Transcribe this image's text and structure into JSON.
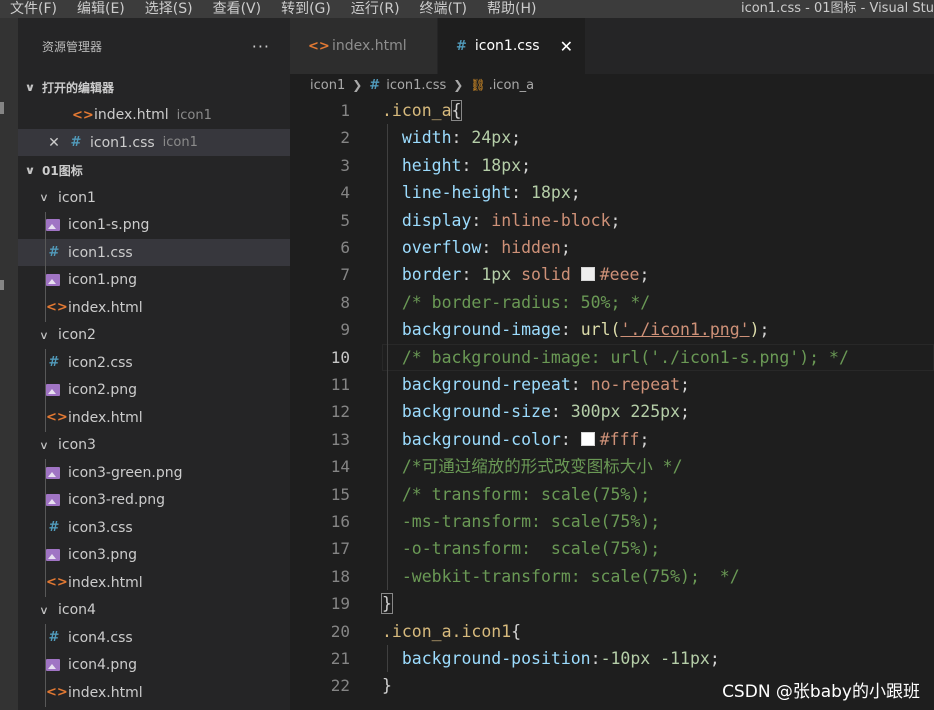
{
  "menu": {
    "items": [
      "文件(F)",
      "编辑(E)",
      "选择(S)",
      "查看(V)",
      "转到(G)",
      "运行(R)",
      "终端(T)",
      "帮助(H)"
    ],
    "window_title": "icon1.css - 01图标 - Visual Stu"
  },
  "sidebar": {
    "title": "资源管理器",
    "more": "···",
    "open_editors_label": "打开的编辑器",
    "open_editors": [
      {
        "name": "index.html",
        "desc": "icon1"
      },
      {
        "name": "icon1.css",
        "desc": "icon1"
      }
    ],
    "root_label": "01图标",
    "folders": [
      {
        "name": "icon1",
        "files": [
          "icon1-s.png",
          "icon1.css",
          "icon1.png",
          "index.html"
        ]
      },
      {
        "name": "icon2",
        "files": [
          "icon2.css",
          "icon2.png",
          "index.html"
        ]
      },
      {
        "name": "icon3",
        "files": [
          "icon3-green.png",
          "icon3-red.png",
          "icon3.css",
          "icon3.png",
          "index.html"
        ]
      },
      {
        "name": "icon4",
        "files": [
          "icon4.css",
          "icon4.png",
          "index.html"
        ]
      }
    ]
  },
  "tabs": [
    {
      "label": "index.html",
      "icon": "html-file-icon",
      "active": false
    },
    {
      "label": "icon1.css",
      "icon": "css-file-icon",
      "active": true
    }
  ],
  "breadcrumb": {
    "folder": "icon1",
    "file": "icon1.css",
    "symbol": ".icon_a"
  },
  "editor": {
    "current_line": 10,
    "line_numbers": [
      "1",
      "2",
      "3",
      "4",
      "5",
      "6",
      "7",
      "8",
      "9",
      "10",
      "11",
      "12",
      "13",
      "14",
      "15",
      "16",
      "17",
      "18",
      "19",
      "20",
      "21",
      "22"
    ],
    "lines": [
      [
        {
          "t": ".icon_a",
          "c": "sel"
        },
        {
          "t": "{",
          "c": "punc",
          "hl": true
        }
      ],
      [
        {
          "t": "  "
        },
        {
          "t": "width",
          "c": "prop"
        },
        {
          "t": ": "
        },
        {
          "t": "24px",
          "c": "num"
        },
        {
          "t": ";"
        }
      ],
      [
        {
          "t": "  "
        },
        {
          "t": "height",
          "c": "prop"
        },
        {
          "t": ": "
        },
        {
          "t": "18px",
          "c": "num"
        },
        {
          "t": ";"
        }
      ],
      [
        {
          "t": "  "
        },
        {
          "t": "line-height",
          "c": "prop"
        },
        {
          "t": ": "
        },
        {
          "t": "18px",
          "c": "num"
        },
        {
          "t": ";"
        }
      ],
      [
        {
          "t": "  "
        },
        {
          "t": "display",
          "c": "prop"
        },
        {
          "t": ": "
        },
        {
          "t": "inline-block",
          "c": "val"
        },
        {
          "t": ";"
        }
      ],
      [
        {
          "t": "  "
        },
        {
          "t": "overflow",
          "c": "prop"
        },
        {
          "t": ": "
        },
        {
          "t": "hidden",
          "c": "val"
        },
        {
          "t": ";"
        }
      ],
      [
        {
          "t": "  "
        },
        {
          "t": "border",
          "c": "prop"
        },
        {
          "t": ": "
        },
        {
          "t": "1px",
          "c": "num"
        },
        {
          "t": " "
        },
        {
          "t": "solid",
          "c": "val"
        },
        {
          "t": " "
        },
        {
          "swatch": "#eeeeee"
        },
        {
          "t": "#eee",
          "c": "val"
        },
        {
          "t": ";"
        }
      ],
      [
        {
          "t": "  "
        },
        {
          "t": "/* border-radius: 50%; */",
          "c": "com"
        }
      ],
      [
        {
          "t": "  "
        },
        {
          "t": "background-image",
          "c": "prop"
        },
        {
          "t": ": "
        },
        {
          "t": "url(",
          "c": "fn"
        },
        {
          "t": "'./icon1.png'",
          "c": "val",
          "u": true
        },
        {
          "t": ")",
          "c": "fn"
        },
        {
          "t": ";"
        }
      ],
      [
        {
          "t": "  "
        },
        {
          "t": "/* background-image: url('./icon1-s.png'); */",
          "c": "com"
        }
      ],
      [
        {
          "t": "  "
        },
        {
          "t": "background-repeat",
          "c": "prop"
        },
        {
          "t": ": "
        },
        {
          "t": "no-repeat",
          "c": "val"
        },
        {
          "t": ";"
        }
      ],
      [
        {
          "t": "  "
        },
        {
          "t": "background-size",
          "c": "prop"
        },
        {
          "t": ": "
        },
        {
          "t": "300px",
          "c": "num"
        },
        {
          "t": " "
        },
        {
          "t": "225px",
          "c": "num"
        },
        {
          "t": ";"
        }
      ],
      [
        {
          "t": "  "
        },
        {
          "t": "background-color",
          "c": "prop"
        },
        {
          "t": ": "
        },
        {
          "swatch": "#ffffff"
        },
        {
          "t": "#fff",
          "c": "val"
        },
        {
          "t": ";"
        }
      ],
      [
        {
          "t": "  "
        },
        {
          "t": "/*可通过缩放的形式改变图标大小 */",
          "c": "com"
        }
      ],
      [
        {
          "t": "  "
        },
        {
          "t": "/* transform: scale(75%);",
          "c": "com"
        }
      ],
      [
        {
          "t": "  "
        },
        {
          "t": "-ms-transform: scale(75%);",
          "c": "com"
        }
      ],
      [
        {
          "t": "  "
        },
        {
          "t": "-o-transform:  scale(75%);",
          "c": "com"
        }
      ],
      [
        {
          "t": "  "
        },
        {
          "t": "-webkit-transform: scale(75%);  */",
          "c": "com"
        }
      ],
      [
        {
          "t": "}",
          "c": "punc",
          "hl": true
        }
      ],
      [
        {
          "t": ".icon_a.icon1",
          "c": "sel"
        },
        {
          "t": "{"
        }
      ],
      [
        {
          "t": "  "
        },
        {
          "t": "background-position",
          "c": "prop"
        },
        {
          "t": ":"
        },
        {
          "t": "-10px",
          "c": "num"
        },
        {
          "t": " "
        },
        {
          "t": "-11px",
          "c": "num"
        },
        {
          "t": ";"
        }
      ],
      [
        {
          "t": "}"
        }
      ]
    ]
  },
  "watermark": "CSDN @张baby的小跟班",
  "colors": {
    "selector": "#d7ba7d",
    "property": "#9cdcfe",
    "number": "#b5cea8",
    "value": "#ce9178",
    "comment": "#6a9955"
  }
}
